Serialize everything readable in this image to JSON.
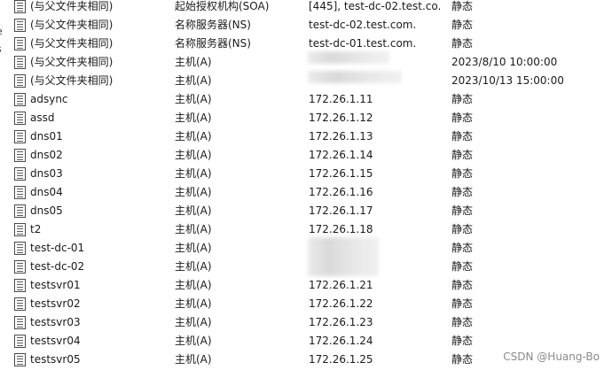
{
  "edge_fragments": [
    "e",
    "s"
  ],
  "rows": [
    {
      "name": "(与父文件夹相同)",
      "type": "起始授权机构(SOA)",
      "data": "[445], test-dc-02.test.co...",
      "timestamp": "静态"
    },
    {
      "name": "(与父文件夹相同)",
      "type": "名称服务器(NS)",
      "data": "test-dc-02.test.com.",
      "timestamp": "静态"
    },
    {
      "name": "(与父文件夹相同)",
      "type": "名称服务器(NS)",
      "data": "test-dc-01.test.com.",
      "timestamp": "静态"
    },
    {
      "name": "(与父文件夹相同)",
      "type": "主机(A)",
      "data": "",
      "timestamp": "2023/8/10 10:00:00"
    },
    {
      "name": "(与父文件夹相同)",
      "type": "主机(A)",
      "data": "",
      "timestamp": "2023/10/13 15:00:00"
    },
    {
      "name": "adsync",
      "type": "主机(A)",
      "data": "172.26.1.11",
      "timestamp": "静态"
    },
    {
      "name": "assd",
      "type": "主机(A)",
      "data": "172.26.1.12",
      "timestamp": "静态"
    },
    {
      "name": "dns01",
      "type": "主机(A)",
      "data": "172.26.1.13",
      "timestamp": "静态"
    },
    {
      "name": "dns02",
      "type": "主机(A)",
      "data": "172.26.1.14",
      "timestamp": "静态"
    },
    {
      "name": "dns03",
      "type": "主机(A)",
      "data": "172.26.1.15",
      "timestamp": "静态"
    },
    {
      "name": "dns04",
      "type": "主机(A)",
      "data": "172.26.1.16",
      "timestamp": "静态"
    },
    {
      "name": "dns05",
      "type": "主机(A)",
      "data": "172.26.1.17",
      "timestamp": "静态"
    },
    {
      "name": "t2",
      "type": "主机(A)",
      "data": "172.26.1.18",
      "timestamp": "静态"
    },
    {
      "name": "test-dc-01",
      "type": "主机(A)",
      "data": "",
      "timestamp": "静态"
    },
    {
      "name": "test-dc-02",
      "type": "主机(A)",
      "data": "",
      "timestamp": "静态"
    },
    {
      "name": "testsvr01",
      "type": "主机(A)",
      "data": "172.26.1.21",
      "timestamp": "静态"
    },
    {
      "name": "testsvr02",
      "type": "主机(A)",
      "data": "172.26.1.22",
      "timestamp": "静态"
    },
    {
      "name": "testsvr03",
      "type": "主机(A)",
      "data": "172.26.1.23",
      "timestamp": "静态"
    },
    {
      "name": "testsvr04",
      "type": "主机(A)",
      "data": "172.26.1.24",
      "timestamp": "静态"
    },
    {
      "name": "testsvr05",
      "type": "主机(A)",
      "data": "172.26.1.25",
      "timestamp": "静态"
    }
  ],
  "watermark": "CSDN @Huang-Bo",
  "colors": {
    "text": "#1a1a1a",
    "icon_border": "#4a4a4a",
    "watermark": "#8a8a8a",
    "background": "#ffffff"
  }
}
